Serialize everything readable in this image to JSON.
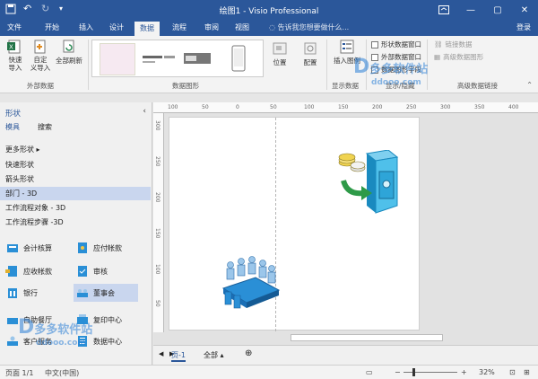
{
  "window": {
    "title": "绘图1 - Visio Professional",
    "minimize": "—",
    "restore": "▢",
    "close": "✕"
  },
  "tabs": [
    "文件",
    "开始",
    "插入",
    "设计",
    "数据",
    "流程",
    "审阅",
    "视图"
  ],
  "active_tab": "数据",
  "tell_me": "告诉我您想要做什么...",
  "login": "登录",
  "ribbon": {
    "external_data": {
      "label": "外部数据",
      "quick_import": "快速\n导入",
      "custom_import": "自定\n义导入",
      "refresh_all": "全部刷新"
    },
    "data_graphics": {
      "label": "数据图形"
    },
    "position": "位置",
    "config": "配置",
    "insert_legend": "插入图例",
    "display_data": {
      "label": "显示数据"
    },
    "checkboxes": [
      "形状数据窗口",
      "外部数据窗口",
      "数据图形字段"
    ],
    "links": [
      "链接数据",
      "高级数据图形"
    ],
    "show_hide": "显示/隐藏",
    "advanced_link": "高级数据链接"
  },
  "shapes_pane": {
    "title": "形状",
    "tab_stencils": "模具",
    "tab_search": "搜索",
    "more_shapes": "更多形状",
    "stencils": [
      "快速形状",
      "箭头形状",
      "部门 - 3D",
      "工作流程对象 - 3D",
      "工作流程步骤 -3D"
    ],
    "selected_stencil": "部门 - 3D",
    "masters": [
      "会计核算",
      "应付帐款",
      "应收帐款",
      "审核",
      "银行",
      "董事会",
      "自助餐厅",
      "复印中心",
      "客户服务",
      "数据中心"
    ]
  },
  "page_tabs": {
    "page1": "页-1",
    "all": "全部",
    "add": "⊕"
  },
  "status": {
    "page": "页面 1/1",
    "language": "中文(中国)",
    "zoom": "32%"
  },
  "watermark": {
    "brand": "多多软件站",
    "site": "ddooo.com"
  },
  "colors": {
    "accent": "#2b579a",
    "selected": "#c9d6ee"
  },
  "rulers": {
    "top": [
      "100",
      "50",
      "0",
      "50",
      "100",
      "150",
      "200",
      "250",
      "300",
      "350",
      "400"
    ],
    "left": [
      "300",
      "250",
      "200",
      "150",
      "100",
      "50"
    ]
  }
}
